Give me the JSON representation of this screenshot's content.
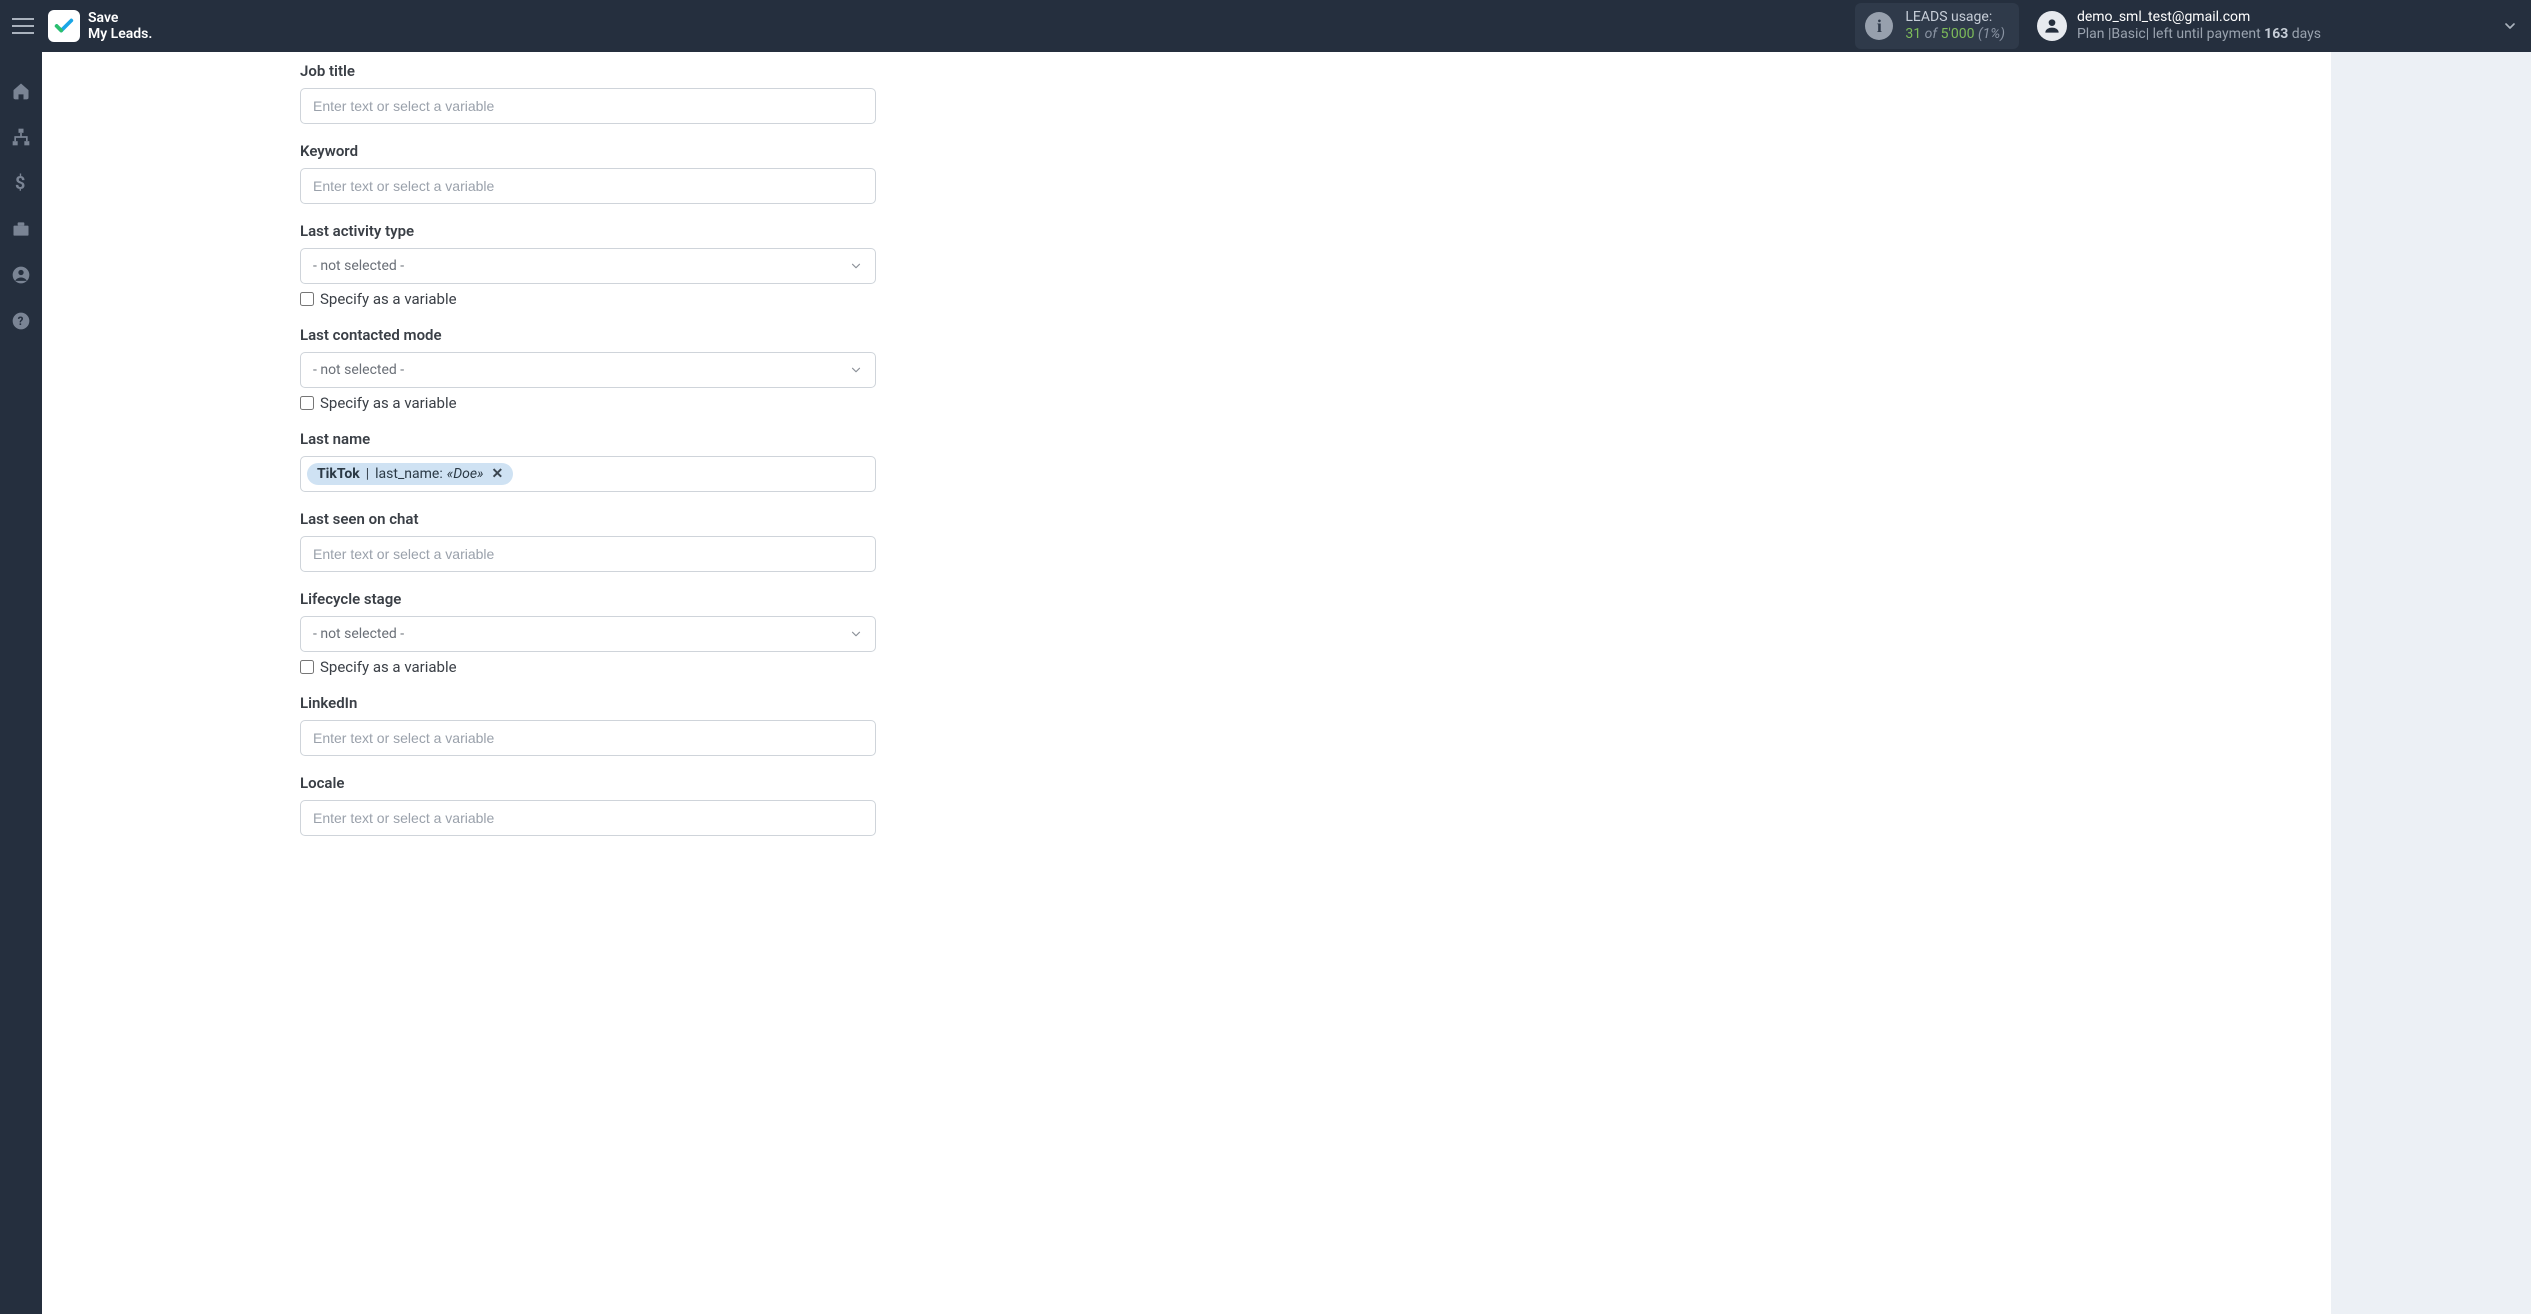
{
  "brand": {
    "line1": "Save",
    "line2": "My Leads."
  },
  "leads_usage": {
    "title": "LEADS usage:",
    "used": "31",
    "of": "of",
    "total": "5'000",
    "pct": "(1%)"
  },
  "account": {
    "email": "demo_sml_test@gmail.com",
    "plan_prefix": "Plan |",
    "plan_name": "Basic",
    "plan_mid": "| left until payment ",
    "days": "163",
    "plan_suffix": " days"
  },
  "common": {
    "placeholder": "Enter text or select a variable",
    "not_selected": "- not selected -",
    "specify_var": "Specify as a variable"
  },
  "fields": {
    "job_title": {
      "label": "Job title"
    },
    "keyword": {
      "label": "Keyword"
    },
    "last_activity_type": {
      "label": "Last activity type"
    },
    "last_contacted_mode": {
      "label": "Last contacted mode"
    },
    "last_name": {
      "label": "Last name",
      "chip": {
        "source": "TikTok",
        "field": "last_name:",
        "value": "«Doe»"
      }
    },
    "last_seen_chat": {
      "label": "Last seen on chat"
    },
    "lifecycle_stage": {
      "label": "Lifecycle stage"
    },
    "linkedin": {
      "label": "LinkedIn"
    },
    "locale": {
      "label": "Locale"
    }
  }
}
